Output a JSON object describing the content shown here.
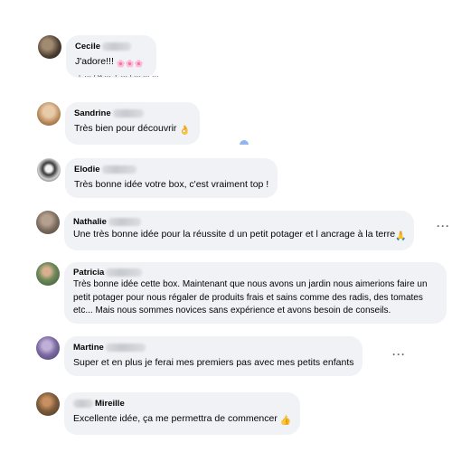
{
  "comments": [
    {
      "name": "Cecile",
      "text": "J'adore!!!",
      "emoji": "🌸🌸🌸",
      "avatar_color": "#5a4a3a"
    },
    {
      "name": "Sandrine",
      "text": "Très bien pour découvrir",
      "emoji": "👌",
      "avatar_color": "#c9a27a"
    },
    {
      "name": "Elodie",
      "text": "Très bonne idée votre box, c'est vraiment top !",
      "emoji": "",
      "avatar_color": "#3a3a3a"
    },
    {
      "name": "Nathalie",
      "text": "Une très bonne idée pour la réussite d un petit potager et l ancrage à la terre",
      "emoji": "🙏",
      "avatar_color": "#8a7a6c"
    },
    {
      "name": "Patricia",
      "text": "Très bonne idée cette box. Maintenant que nous avons un jardin nous aimerions faire un petit potager pour nous régaler de produits frais et sains comme des radis, des tomates etc... Mais nous sommes novices sans expérience et avons besoin de conseils.",
      "emoji": "",
      "avatar_color": "#6d8a5a"
    },
    {
      "name": "Martine",
      "text": "Super et en plus je ferai mes premiers pas avec mes petits enfants",
      "emoji": "",
      "avatar_color": "#7a6aa0"
    },
    {
      "name": "Mireille",
      "text": "Excellente idée, ça me permettra de commencer",
      "emoji": "👍",
      "avatar_color": "#7a5a3a"
    }
  ],
  "more_label": "···"
}
